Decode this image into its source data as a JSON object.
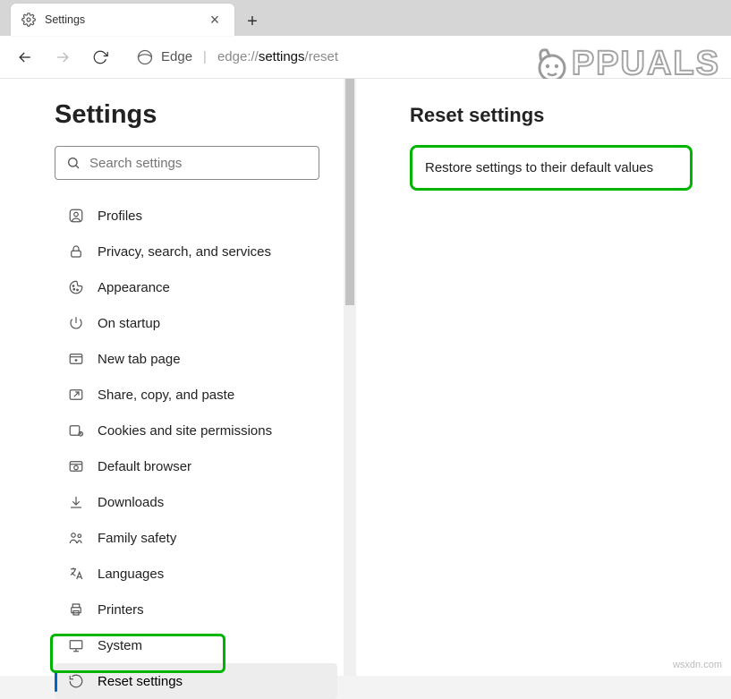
{
  "tab": {
    "title": "Settings"
  },
  "toolbar": {
    "siteLabel": "Edge",
    "url_prefix": "edge://",
    "url_strong": "settings",
    "url_suffix": "/reset"
  },
  "sidebar": {
    "title": "Settings",
    "search_placeholder": "Search settings",
    "items": [
      {
        "label": "Profiles"
      },
      {
        "label": "Privacy, search, and services"
      },
      {
        "label": "Appearance"
      },
      {
        "label": "On startup"
      },
      {
        "label": "New tab page"
      },
      {
        "label": "Share, copy, and paste"
      },
      {
        "label": "Cookies and site permissions"
      },
      {
        "label": "Default browser"
      },
      {
        "label": "Downloads"
      },
      {
        "label": "Family safety"
      },
      {
        "label": "Languages"
      },
      {
        "label": "Printers"
      },
      {
        "label": "System"
      },
      {
        "label": "Reset settings"
      }
    ]
  },
  "main": {
    "heading": "Reset settings",
    "restore_label": "Restore settings to their default values"
  },
  "watermark": {
    "a": "A",
    "rest": "PPUALS"
  },
  "credit": "wsxdn.com"
}
